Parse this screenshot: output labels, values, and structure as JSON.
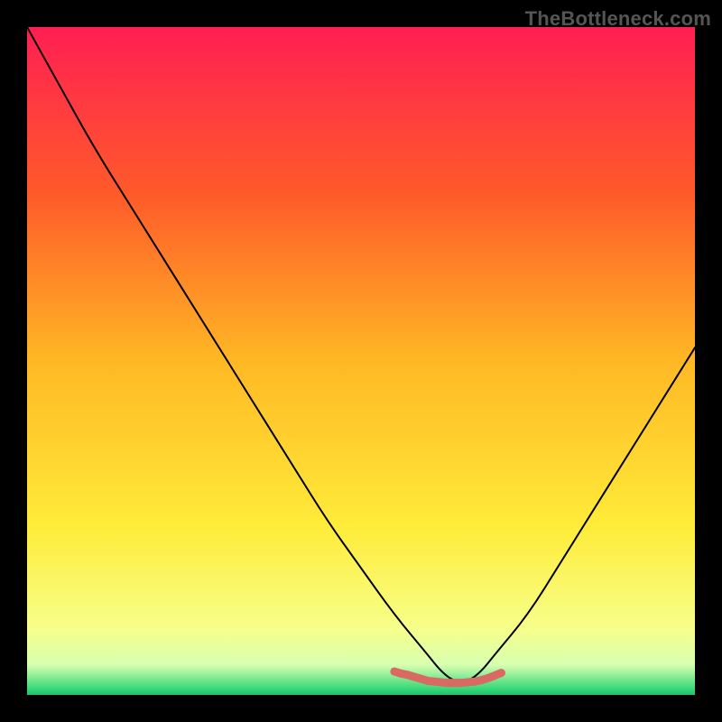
{
  "watermark": "TheBottleneck.com",
  "chart_data": {
    "type": "line",
    "title": "",
    "xlabel": "",
    "ylabel": "",
    "xlim": [
      0,
      100
    ],
    "ylim": [
      0,
      100
    ],
    "background_gradient_stops": [
      {
        "offset": 0.0,
        "color": "#ff1f52"
      },
      {
        "offset": 0.25,
        "color": "#ff5a2a"
      },
      {
        "offset": 0.5,
        "color": "#ffb824"
      },
      {
        "offset": 0.75,
        "color": "#ffec3a"
      },
      {
        "offset": 0.9,
        "color": "#f7ff8a"
      },
      {
        "offset": 0.955,
        "color": "#d8ffb0"
      },
      {
        "offset": 0.99,
        "color": "#3bd97a"
      },
      {
        "offset": 1.0,
        "color": "#19c36a"
      }
    ],
    "series": [
      {
        "name": "v-curve",
        "stroke": "#000000",
        "x": [
          0,
          5,
          10,
          15,
          20,
          25,
          30,
          35,
          40,
          45,
          50,
          55,
          60,
          62,
          64,
          66,
          68,
          70,
          75,
          80,
          85,
          90,
          95,
          100
        ],
        "values": [
          100,
          91,
          82,
          74,
          66,
          58,
          50,
          42,
          34,
          26,
          19,
          12,
          6,
          3.5,
          2,
          2,
          3.5,
          6,
          12,
          20,
          28,
          36,
          44,
          52
        ]
      },
      {
        "name": "highlight-band",
        "stroke": "#d86a63",
        "stroke_width": 9,
        "x": [
          55,
          56,
          57,
          58,
          59,
          60,
          61,
          62,
          63,
          64,
          65,
          66,
          67,
          68,
          69,
          70,
          71
        ],
        "values": [
          3.5,
          3.2,
          3.0,
          2.7,
          2.4,
          2.1,
          2.0,
          1.9,
          1.8,
          1.8,
          1.8,
          1.9,
          2.0,
          2.2,
          2.5,
          2.9,
          3.3
        ]
      }
    ]
  }
}
